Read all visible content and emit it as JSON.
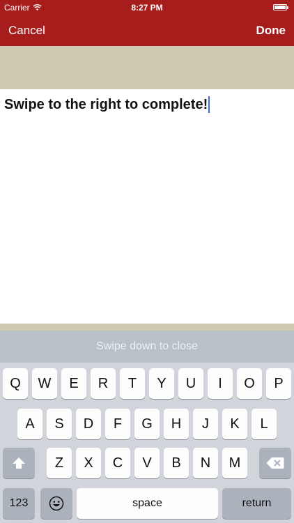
{
  "status_bar": {
    "carrier": "Carrier",
    "time": "8:27 PM"
  },
  "nav": {
    "cancel": "Cancel",
    "done": "Done"
  },
  "editor": {
    "text": "Swipe to the right to complete!"
  },
  "hint": "Swipe down to close",
  "keyboard": {
    "row1": [
      "Q",
      "W",
      "E",
      "R",
      "T",
      "Y",
      "U",
      "I",
      "O",
      "P"
    ],
    "row2": [
      "A",
      "S",
      "D",
      "F",
      "G",
      "H",
      "J",
      "K",
      "L"
    ],
    "row3": [
      "Z",
      "X",
      "C",
      "V",
      "B",
      "N",
      "M"
    ],
    "numbers": "123",
    "space": "space",
    "return": "return"
  },
  "colors": {
    "nav_red": "#a61d1c",
    "band": "#cdcab0",
    "caret": "#3b6fe0"
  }
}
